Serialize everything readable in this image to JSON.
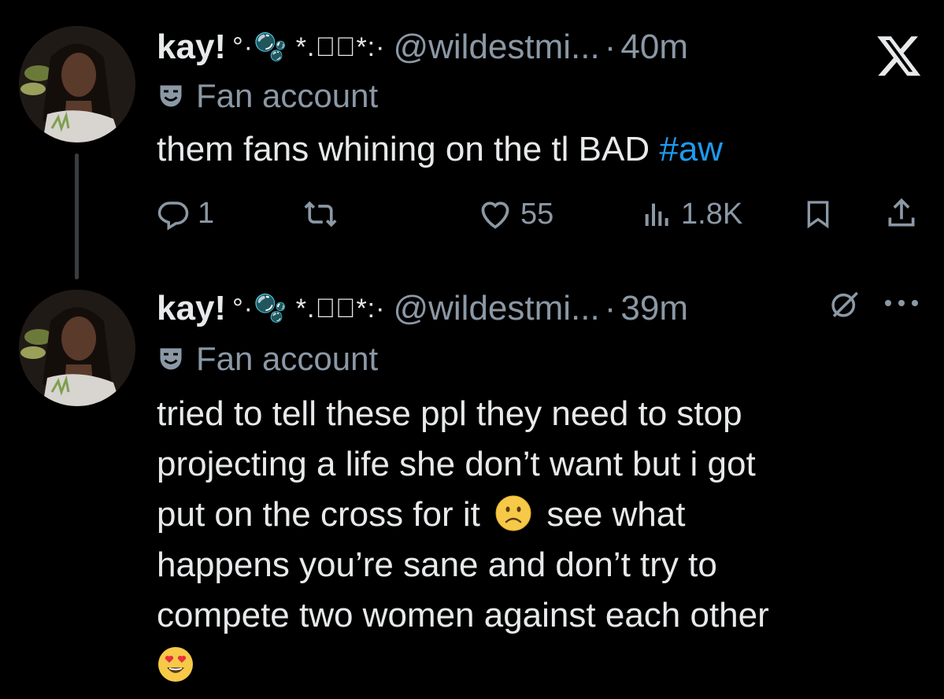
{
  "tweets": [
    {
      "display_name": "kay!",
      "name_decoration": "°·🫧 *.⸙ૂ*:·",
      "handle": "@wildestmi...",
      "separator": "·",
      "time": "40m",
      "badge_label": "Fan account",
      "text": "them fans whining on the tl BAD",
      "hashtag": "#aw",
      "reply_count": "1",
      "retweet_count": "",
      "like_count": "55",
      "view_count": "1.8K"
    },
    {
      "display_name": "kay!",
      "name_decoration": "°·🫧 *.⸙ૂ*:·",
      "handle": "@wildestmi...",
      "separator": "·",
      "time": "39m",
      "badge_label": "Fan account",
      "text_lines": [
        "tried to tell these ppl they need to stop",
        "projecting a life she don’t want but i got",
        "put on the cross for it",
        "see what",
        "happens you’re sane and don’t try to",
        "compete two women against each other"
      ]
    }
  ],
  "icons": {
    "top_right": "x-logo-icon",
    "tweet2_right": [
      "grok-icon",
      "more-icon"
    ]
  },
  "colors": {
    "background": "#000000",
    "text": "#e7e9ea",
    "muted": "#8b98a5",
    "link": "#1d9bf0"
  }
}
